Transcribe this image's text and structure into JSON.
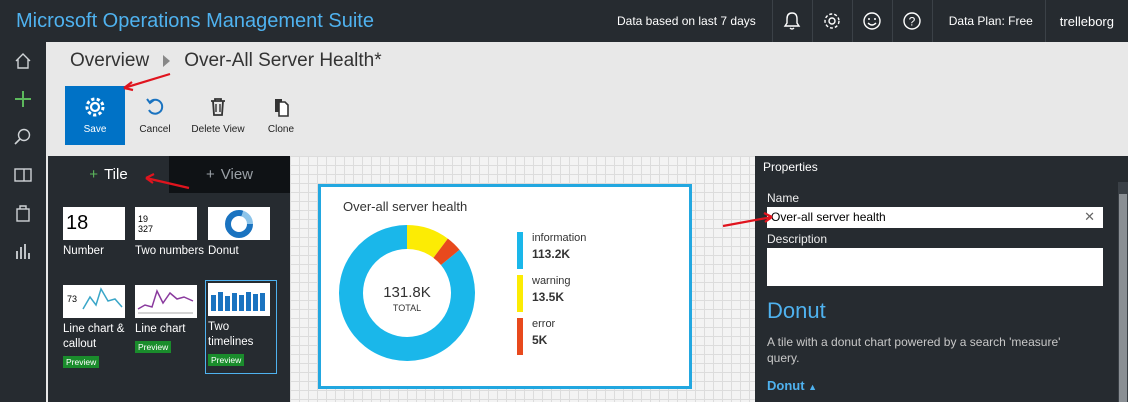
{
  "header": {
    "app_title": "Microsoft Operations Management Suite",
    "data_note": "Data based on last 7 days",
    "data_plan": "Data Plan: Free",
    "user": "trelleborg"
  },
  "breadcrumb": {
    "root": "Overview",
    "current": "Over-All Server Health*"
  },
  "toolbar": {
    "save": "Save",
    "cancel": "Cancel",
    "delete_view": "Delete View",
    "clone": "Clone"
  },
  "gallery": {
    "tabs": {
      "tile": "Tile",
      "view": "View",
      "plus": "+"
    },
    "preview_badge": "Preview",
    "tiles": [
      {
        "label": "Number",
        "thumb_text": "18"
      },
      {
        "label": "Two numbers",
        "thumb_line1": "19",
        "thumb_line2": "327"
      },
      {
        "label": "Donut"
      },
      {
        "label": "Line chart & callout",
        "thumb_text": "73",
        "preview": true
      },
      {
        "label": "Line chart",
        "preview": true
      },
      {
        "label": "Two timelines",
        "preview": true
      }
    ]
  },
  "card": {
    "title": "Over-all server health",
    "total_value": "131.8K",
    "total_label": "TOTAL",
    "legend": [
      {
        "name": "information",
        "value": "113.2K",
        "color": "#1ab7ea"
      },
      {
        "name": "warning",
        "value": "13.5K",
        "color": "#fcec04"
      },
      {
        "name": "error",
        "value": "5K",
        "color": "#e8491d"
      }
    ]
  },
  "properties": {
    "title": "Properties",
    "name_label": "Name",
    "name_value": "Over-all server health",
    "description_label": "Description",
    "tile_name": "Donut",
    "tile_description": "A tile with a donut chart powered by a search 'measure' query.",
    "tile_link": "Donut"
  },
  "colors": {
    "accent": "#0072c6",
    "title_blue": "#4fb2ef",
    "dark_panel": "#262b30",
    "arrow_red": "#e0141e"
  }
}
